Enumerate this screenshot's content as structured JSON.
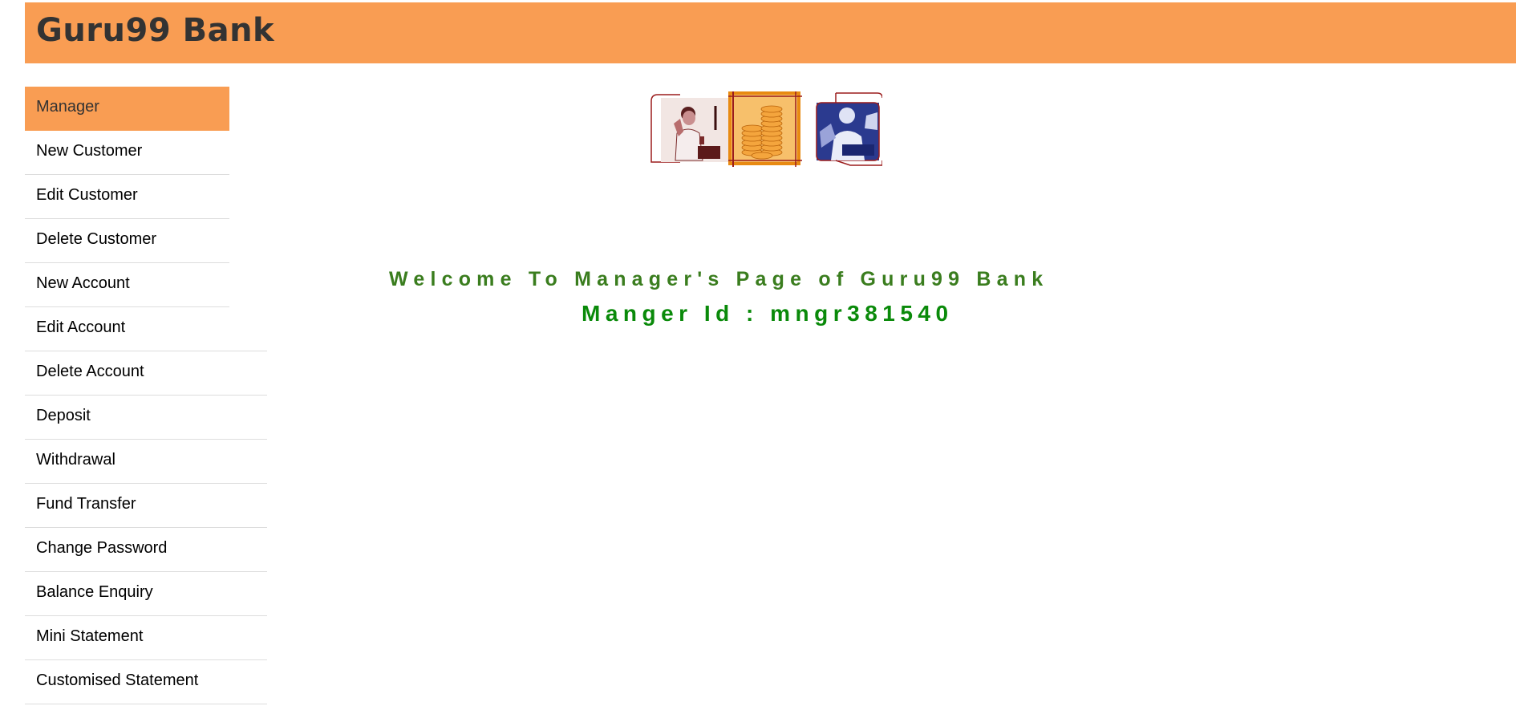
{
  "header": {
    "title": "Guru99 Bank"
  },
  "sidebar": {
    "items": [
      {
        "label": "Manager"
      },
      {
        "label": "New Customer"
      },
      {
        "label": "Edit Customer"
      },
      {
        "label": "Delete Customer"
      },
      {
        "label": "New Account"
      },
      {
        "label": "Edit Account"
      },
      {
        "label": "Delete Account"
      },
      {
        "label": "Deposit"
      },
      {
        "label": "Withdrawal"
      },
      {
        "label": "Fund Transfer"
      },
      {
        "label": "Change Password"
      },
      {
        "label": "Balance Enquiry"
      },
      {
        "label": "Mini Statement"
      },
      {
        "label": "Customised Statement"
      }
    ]
  },
  "main": {
    "welcome_text": "Welcome To Manager's Page of Guru99 Bank",
    "manager_id_text": "Manger Id : mngr381540"
  },
  "colors": {
    "accent": "#f99d53",
    "welcome_green": "#3a7d1e",
    "id_green": "#0a8a0a"
  },
  "icons": {
    "banner": "bank-banner-image"
  }
}
